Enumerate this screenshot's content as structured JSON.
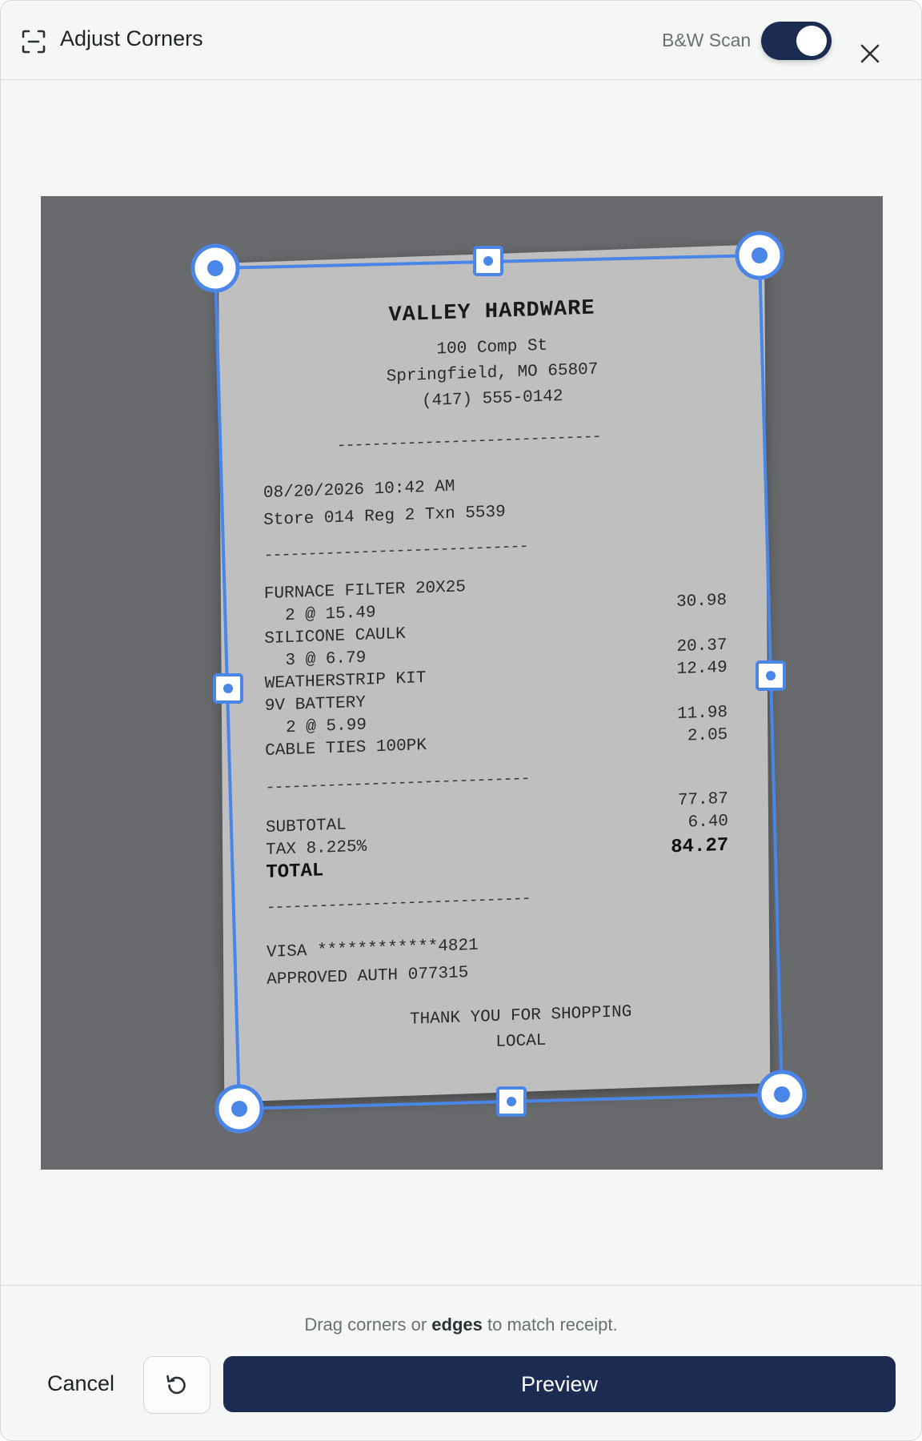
{
  "header": {
    "title": "Adjust Corners",
    "bw_scan_label": "B&W Scan",
    "bw_scan_enabled": true
  },
  "receipt": {
    "store_name": "VALLEY HARDWARE",
    "address_line1": "100 Comp St",
    "address_line2": "Springfield, MO 65807",
    "phone": "(417) 555-0142",
    "separator": "------------------------------",
    "separator_short": "------------------------------",
    "datetime": "08/20/2026 10:42 AM",
    "store_info": "Store 014 Reg 2 Txn 5539",
    "items": [
      {
        "name": "FURNACE FILTER 20X25",
        "qty": "2 @ 15.49",
        "amount": "30.98"
      },
      {
        "name": "SILICONE CAULK",
        "qty": "3 @ 6.79",
        "amount": "20.37"
      },
      {
        "name": "WEATHERSTRIP KIT",
        "qty": "",
        "amount": "12.49"
      },
      {
        "name": "9V BATTERY",
        "qty": "2 @ 5.99",
        "amount": "11.98"
      },
      {
        "name": "CABLE TIES 100PK",
        "qty": "",
        "amount": "2.05"
      }
    ],
    "subtotal_label": "SUBTOTAL",
    "subtotal": "77.87",
    "tax_label": "TAX 8.225%",
    "tax": "6.40",
    "total_label": "TOTAL",
    "total": "84.27",
    "card": "VISA ************4821",
    "approval": "APPROVED AUTH 077315",
    "thanks_line1": "THANK YOU FOR SHOPPING",
    "thanks_line2": "LOCAL"
  },
  "footer": {
    "hint_prefix": "Drag corners or ",
    "hint_bold": "edges",
    "hint_suffix": " to match receipt.",
    "cancel_label": "Cancel",
    "preview_label": "Preview"
  },
  "icons": {
    "scan": "scan-frame-icon",
    "close": "close-icon",
    "reset": "rotate-ccw-icon"
  },
  "colors": {
    "accent": "#4a86e8",
    "primary": "#1b2b52",
    "canvas": "#686a6d",
    "receipt": "#bfbfbf"
  }
}
